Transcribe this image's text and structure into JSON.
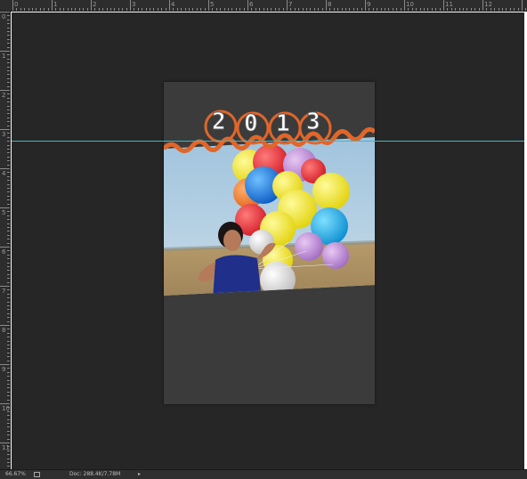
{
  "ruler_top_numbers": [
    "0",
    "1",
    "2",
    "3",
    "4",
    "5",
    "6",
    "7",
    "8",
    "9",
    "10",
    "11",
    "12"
  ],
  "ruler_left_numbers": [
    "0",
    "1",
    "2",
    "3",
    "4",
    "5",
    "6",
    "7",
    "8",
    "9",
    "10",
    "11"
  ],
  "artwork": {
    "year_digits": [
      "2",
      "0",
      "1",
      "3"
    ]
  },
  "status": {
    "zoom": "66.67%",
    "doc_info": "Doc: 288.4K/7.78M",
    "arrow": "▸"
  },
  "colors": {
    "canvas_bg": "#262626",
    "artboard_bg": "#3b3b3b",
    "guide": "#3fb8c4",
    "accent_orange": "#e0662a"
  }
}
